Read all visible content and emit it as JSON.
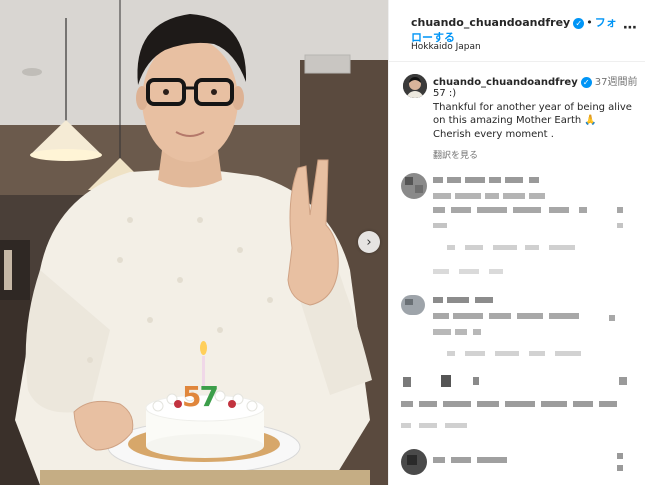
{
  "post": {
    "username": "chuando_chuandoandfrey",
    "follow_label": "フォローする",
    "location": "Hokkaido Japan",
    "more_icon": "more-horizontal-icon"
  },
  "caption": {
    "username": "chuando_chuandoandfrey",
    "time": "37週間前",
    "line1": "57 :)",
    "line2": "Thankful for another year of being alive on this amazing Mother Earth 🙏",
    "line3": "Cherish every moment .",
    "translate_label": "翻訳を見る"
  },
  "photo": {
    "cake_numbers": "57",
    "carousel_icon": "chevron-right-icon"
  },
  "colors": {
    "accent": "#0095f6",
    "sweater": "#f3efe6",
    "background": "#ffffff"
  }
}
